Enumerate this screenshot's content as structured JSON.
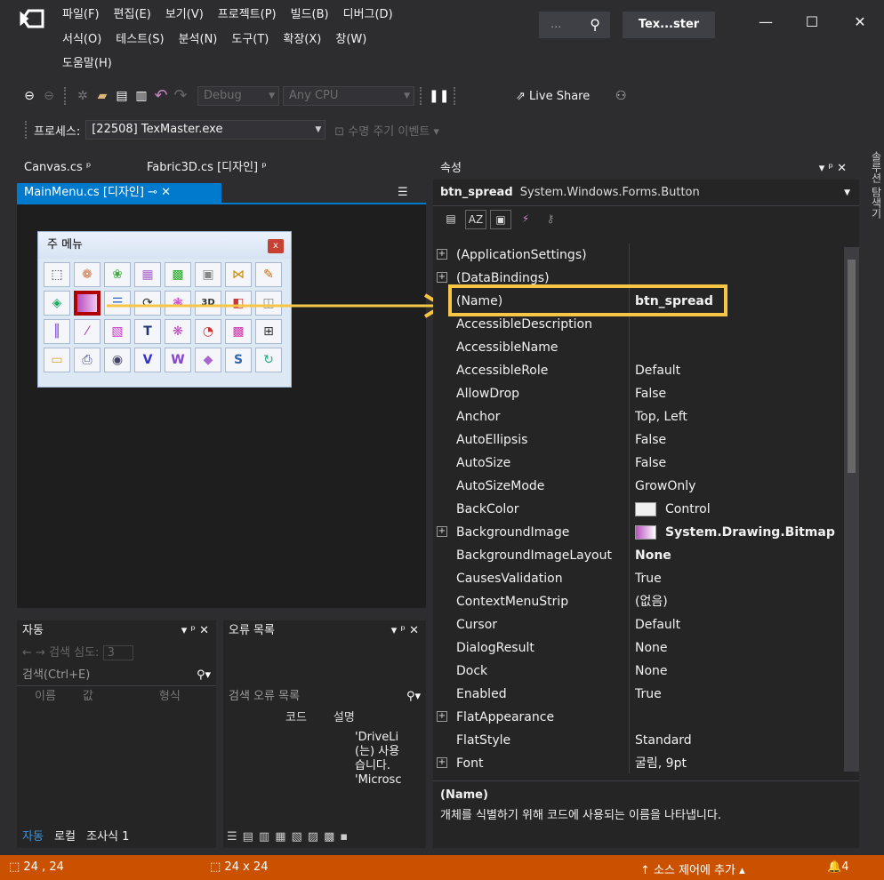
{
  "menu": {
    "row1": [
      "파일(F)",
      "편집(E)",
      "보기(V)",
      "프로젝트(P)",
      "빌드(B)",
      "디버그(D)"
    ],
    "row2": [
      "서식(O)",
      "테스트(S)",
      "분석(N)",
      "도구(T)",
      "확장(X)",
      "창(W)"
    ],
    "row3": [
      "도움말(H)"
    ]
  },
  "titlebar": {
    "search_dots": "...",
    "title": "Tex...ster",
    "minimize": "—",
    "maximize": "☐",
    "close": "✕"
  },
  "toolbar": {
    "config": "Debug",
    "platform": "Any CPU",
    "live_share": "Live Share",
    "process_label": "프로세스:",
    "process_value": "[22508] TexMaster.exe",
    "lifecycle": "수명 주기 이벤트"
  },
  "tabs": {
    "canvas": "Canvas.cs",
    "fabric": "Fabric3D.cs [디자인]",
    "mainmenu": "MainMenu.cs [디자인]"
  },
  "designer_form": {
    "title": "주 메뉴",
    "close": "x"
  },
  "properties": {
    "panel_title": "속성",
    "object_name": "btn_spread",
    "object_type": "System.Windows.Forms.Button",
    "rows": [
      {
        "name": "(ApplicationSettings)",
        "value": "",
        "expand": "+"
      },
      {
        "name": "(DataBindings)",
        "value": "",
        "expand": "+"
      },
      {
        "name": "(Name)",
        "value": "btn_spread",
        "bold": true
      },
      {
        "name": "AccessibleDescription",
        "value": ""
      },
      {
        "name": "AccessibleName",
        "value": ""
      },
      {
        "name": "AccessibleRole",
        "value": "Default"
      },
      {
        "name": "AllowDrop",
        "value": "False"
      },
      {
        "name": "Anchor",
        "value": "Top, Left"
      },
      {
        "name": "AutoEllipsis",
        "value": "False"
      },
      {
        "name": "AutoSize",
        "value": "False"
      },
      {
        "name": "AutoSizeMode",
        "value": "GrowOnly"
      },
      {
        "name": "BackColor",
        "value": "Control",
        "swatch": "#f0f0f0"
      },
      {
        "name": "BackgroundImage",
        "value": "System.Drawing.Bitmap",
        "expand": "+",
        "bold": true,
        "swatch": "gradient"
      },
      {
        "name": "BackgroundImageLayout",
        "value": "None",
        "bold": true
      },
      {
        "name": "CausesValidation",
        "value": "True"
      },
      {
        "name": "ContextMenuStrip",
        "value": "(없음)"
      },
      {
        "name": "Cursor",
        "value": "Default"
      },
      {
        "name": "DialogResult",
        "value": "None"
      },
      {
        "name": "Dock",
        "value": "None"
      },
      {
        "name": "Enabled",
        "value": "True"
      },
      {
        "name": "FlatAppearance",
        "value": "",
        "expand": "+"
      },
      {
        "name": "FlatStyle",
        "value": "Standard"
      },
      {
        "name": "Font",
        "value": "굴림, 9pt",
        "expand": "+"
      }
    ],
    "desc_title": "(Name)",
    "desc_text": "개체를 식별하기 위해 코드에 사용되는 이름을 나타냅니다."
  },
  "autos": {
    "title": "자동",
    "search_depth_label": "검색 심도:",
    "search_depth": "3",
    "search_placeholder": "검색(Ctrl+E)",
    "col_name": "이름",
    "col_value": "값",
    "col_type": "형식",
    "tabs": [
      "자동",
      "로컬",
      "조사식 1"
    ]
  },
  "errors": {
    "title": "오류 목록",
    "search_placeholder": "검색 오류 목록",
    "col_code": "코드",
    "col_desc": "설명",
    "rows": [
      "'DriveLi",
      "(는) 사용",
      "습니다.",
      "'Microsc"
    ]
  },
  "side": {
    "label": "솔루션 탐색기"
  },
  "status": {
    "position": "24 , 24",
    "size": "24 x 24",
    "source_control": "소스 제어에 추가",
    "notifications": "4"
  },
  "colors": {
    "accent": "#007acc",
    "statusbar": "#ca5100",
    "highlight": "#f6c644",
    "selected_button": "#b00000"
  }
}
